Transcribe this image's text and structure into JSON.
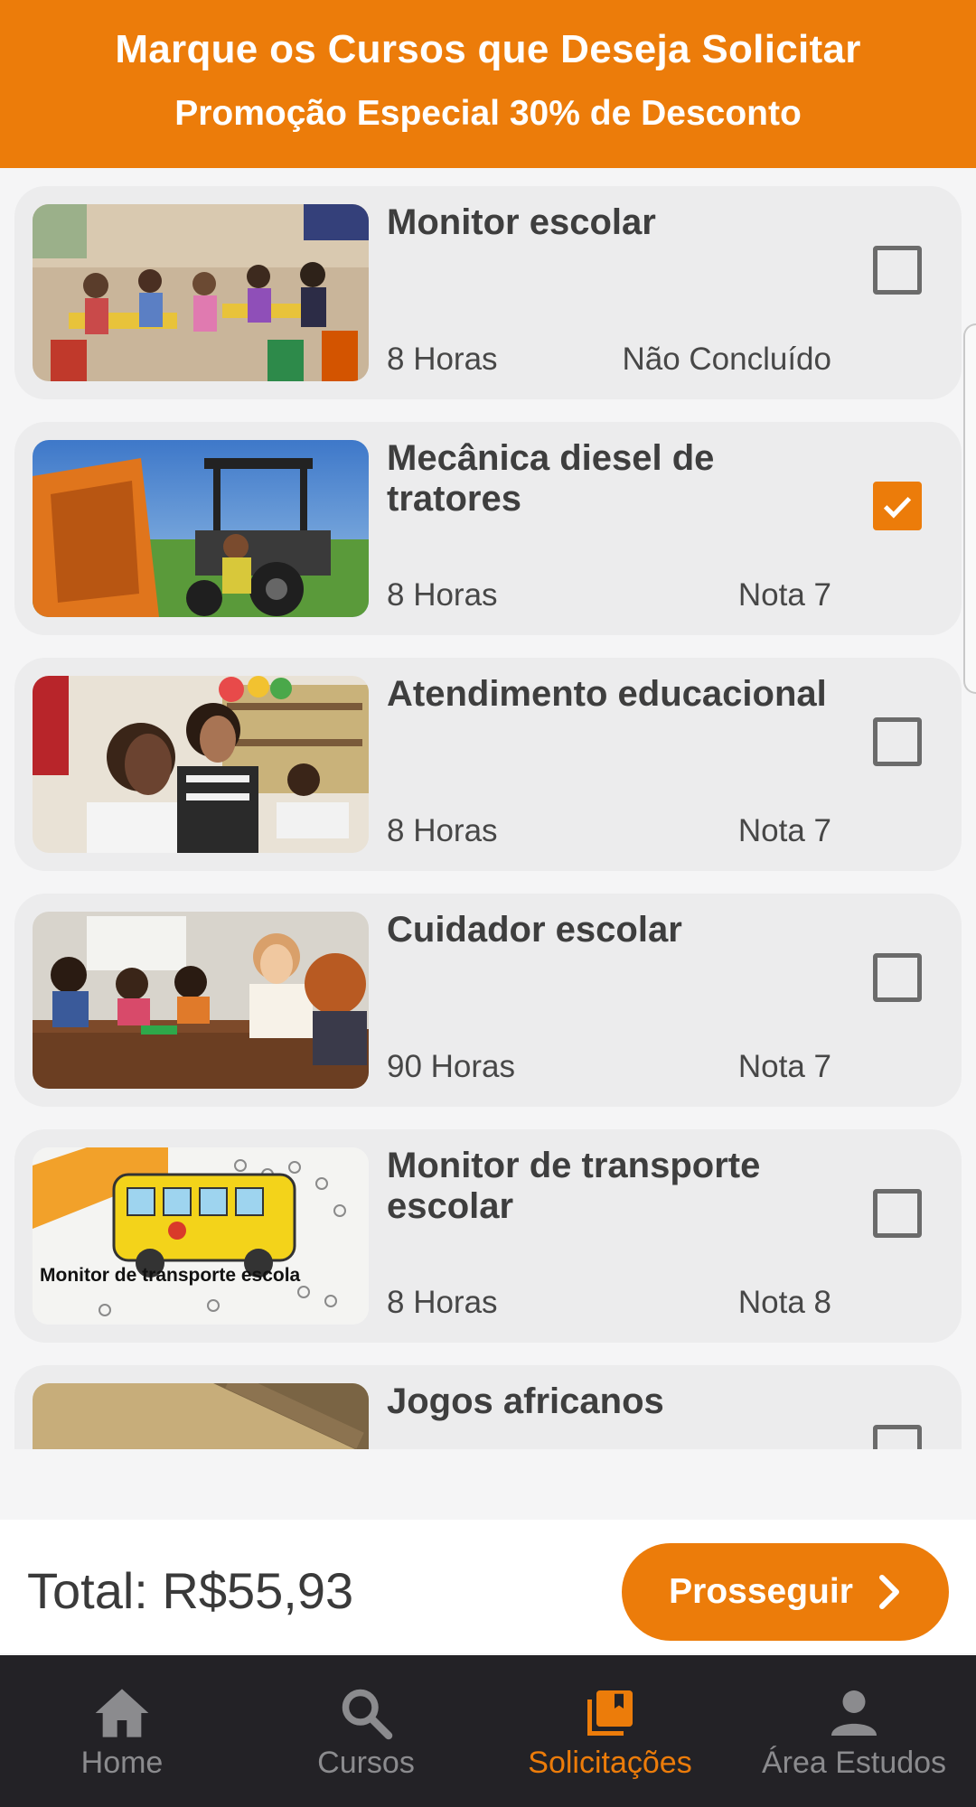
{
  "header": {
    "title": "Marque os Cursos que Deseja Solicitar",
    "subtitle": "Promoção Especial 30% de Desconto"
  },
  "courses": [
    {
      "title": "Monitor escolar",
      "hours": "8 Horas",
      "status": "Não Concluído",
      "checked": false
    },
    {
      "title": "Mecânica diesel de tratores",
      "hours": "8 Horas",
      "status": "Nota 7",
      "checked": true
    },
    {
      "title": "Atendimento educacional",
      "hours": "8 Horas",
      "status": "Nota 7",
      "checked": false
    },
    {
      "title": "Cuidador escolar",
      "hours": "90 Horas",
      "status": "Nota 7",
      "checked": false
    },
    {
      "title": "Monitor de transporte escolar",
      "hours": "8 Horas",
      "status": "Nota 8",
      "checked": false,
      "thumb_caption": "Monitor de transporte escola"
    },
    {
      "title": "Jogos africanos",
      "hours": "",
      "status": "",
      "checked": false
    }
  ],
  "footer": {
    "total_label": "Total: R$55,93",
    "proceed_label": "Prosseguir"
  },
  "nav": {
    "items": [
      {
        "label": "Home",
        "icon": "home-icon",
        "active": false
      },
      {
        "label": "Cursos",
        "icon": "search-icon",
        "active": false
      },
      {
        "label": "Solicitações",
        "icon": "library-books-icon",
        "active": true
      },
      {
        "label": "Área Estudos",
        "icon": "person-icon",
        "active": false
      }
    ]
  },
  "colors": {
    "accent": "#ec7c0a",
    "card_bg": "#ececed",
    "nav_bg": "#232226",
    "nav_inactive": "#8b8b8e"
  }
}
